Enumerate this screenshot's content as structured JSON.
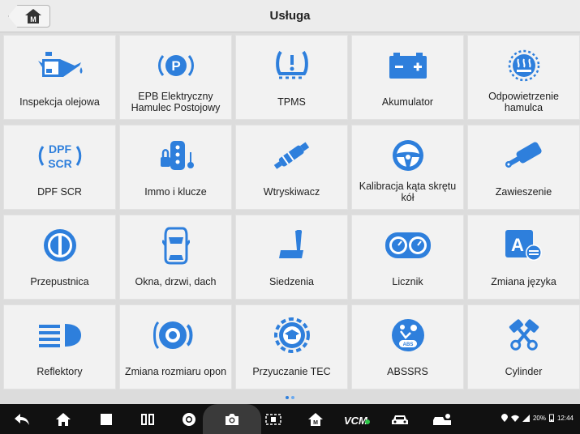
{
  "header": {
    "title": "Usługa",
    "home_button_label": "M"
  },
  "tiles": [
    {
      "label": "Inspekcja olejowa",
      "icon": "oil-can-icon"
    },
    {
      "label": "EPB Elektryczny Hamulec Postojowy",
      "icon": "parking-brake-icon"
    },
    {
      "label": "TPMS",
      "icon": "tire-pressure-icon"
    },
    {
      "label": "Akumulator",
      "icon": "battery-icon"
    },
    {
      "label": "Odpowietrzenie hamulca",
      "icon": "brake-bleed-icon"
    },
    {
      "label": "DPF SCR",
      "icon": "dpf-scr-icon",
      "icon_text": [
        "DPF",
        "SCR"
      ]
    },
    {
      "label": "Immo i klucze",
      "icon": "immo-keys-icon"
    },
    {
      "label": "Wtryskiwacz",
      "icon": "injector-icon"
    },
    {
      "label": "Kalibracja kąta skrętu kół",
      "icon": "steering-wheel-icon"
    },
    {
      "label": "Zawieszenie",
      "icon": "suspension-icon"
    },
    {
      "label": "Przepustnica",
      "icon": "throttle-icon"
    },
    {
      "label": "Okna, drzwi, dach",
      "icon": "car-top-view-icon"
    },
    {
      "label": "Siedzenia",
      "icon": "seat-icon"
    },
    {
      "label": "Licznik",
      "icon": "odometer-icon"
    },
    {
      "label": "Zmiana języka",
      "icon": "language-icon",
      "icon_text": [
        "A"
      ]
    },
    {
      "label": "Reflektory",
      "icon": "headlight-icon"
    },
    {
      "label": "Zmiana rozmiaru opon",
      "icon": "tire-size-icon"
    },
    {
      "label": "Przyuczanie TEC",
      "icon": "tec-learning-icon"
    },
    {
      "label": "ABSSRS",
      "icon": "abs-srs-icon"
    },
    {
      "label": "Cylinder",
      "icon": "cylinder-icon"
    }
  ],
  "pagination": {
    "pages": 2,
    "current": 1
  },
  "status_bar": {
    "battery": "20%",
    "time": "12:44"
  },
  "navbar": {
    "vcm_label": "VCM"
  },
  "colors": {
    "accent": "#2e7fdc",
    "navbar": "#111111",
    "tile": "#f2f2f2"
  }
}
